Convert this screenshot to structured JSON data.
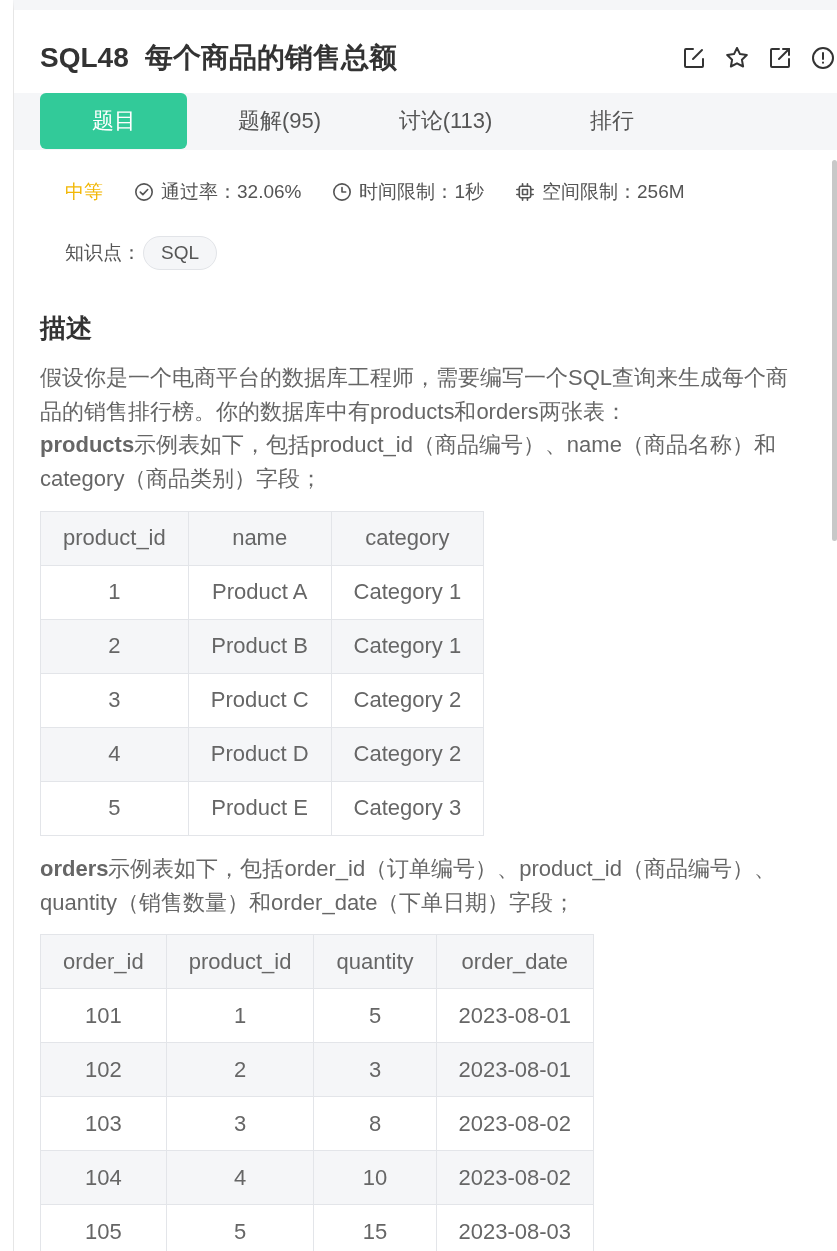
{
  "title": {
    "code": "SQL48",
    "name": "每个商品的销售总额"
  },
  "tabs": [
    {
      "label": "题目",
      "selected": true
    },
    {
      "label": "题解(95)",
      "selected": false
    },
    {
      "label": "讨论(113)",
      "selected": false
    },
    {
      "label": "排行",
      "selected": false
    }
  ],
  "meta": {
    "difficulty": "中等",
    "stats": [
      {
        "kind": "pass_rate",
        "text": "通过率：32.06%"
      },
      {
        "kind": "time_limit",
        "text": "时间限制：1秒"
      },
      {
        "kind": "memory_limit",
        "text": "空间限制：256M"
      }
    ]
  },
  "knowledge": {
    "label": "知识点：",
    "tags": [
      "SQL"
    ]
  },
  "description": {
    "heading": "描述",
    "blocks": [
      {
        "kind": "text",
        "text": "假设你是一个电商平台的数据库工程师，需要编写一个SQL查询来生成每个商品的销售排行榜。你的数据库中有products和orders两张表："
      },
      {
        "kind": "text",
        "text": "**products**示例表如下，包括product_id（商品编号）、name（商品名称）和category（商品类别）字段；"
      },
      {
        "kind": "table",
        "columns": [
          "product_id",
          "name",
          "category"
        ],
        "rows": [
          [
            "1",
            "Product A",
            "Category 1"
          ],
          [
            "2",
            "Product B",
            "Category 1"
          ],
          [
            "3",
            "Product C",
            "Category 2"
          ],
          [
            "4",
            "Product D",
            "Category 2"
          ],
          [
            "5",
            "Product E",
            "Category 3"
          ]
        ]
      },
      {
        "kind": "text",
        "text": "**orders**示例表如下，包括order_id（订单编号）、product_id（商品编号）、quantity（销售数量）和order_date（下单日期）字段；"
      },
      {
        "kind": "table",
        "columns": [
          "order_id",
          "product_id",
          "quantity",
          "order_date"
        ],
        "rows": [
          [
            "101",
            "1",
            "5",
            "2023-08-01"
          ],
          [
            "102",
            "2",
            "3",
            "2023-08-01"
          ],
          [
            "103",
            "3",
            "8",
            "2023-08-02"
          ],
          [
            "104",
            "4",
            "10",
            "2023-08-02"
          ],
          [
            "105",
            "5",
            "15",
            "2023-08-03"
          ]
        ]
      }
    ]
  }
}
